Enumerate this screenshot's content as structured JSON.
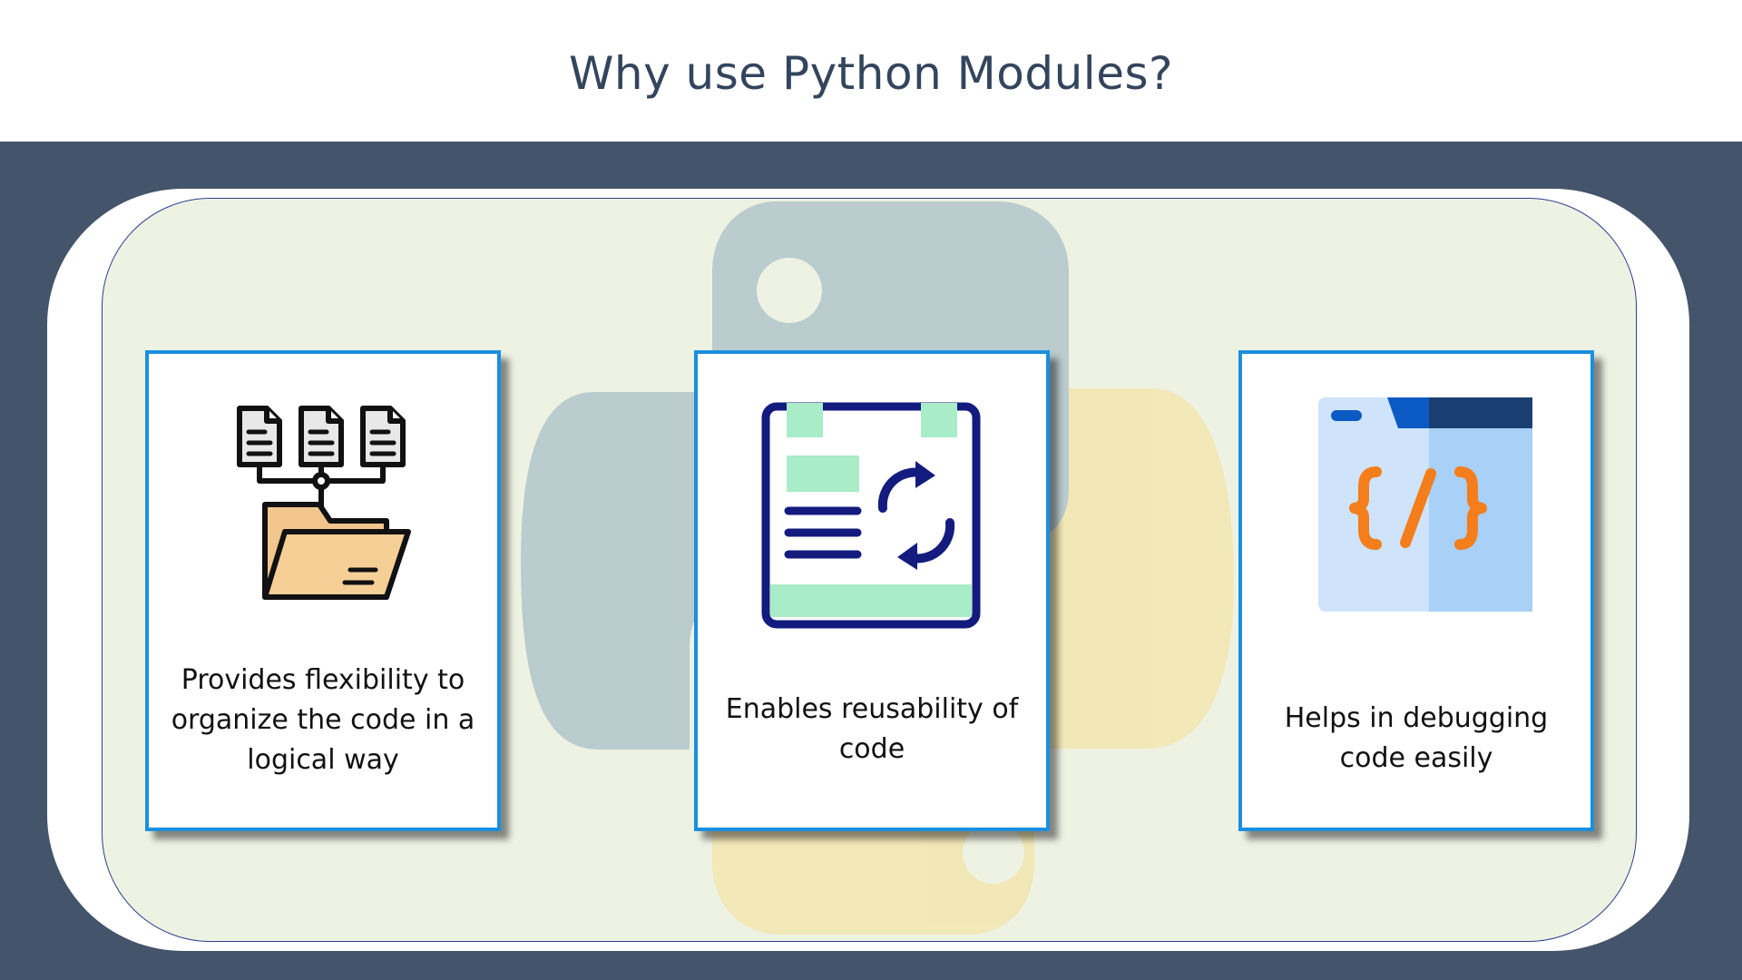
{
  "slide": {
    "title": "Why use Python Modules?"
  },
  "cards": [
    {
      "icon": "folder-documents-icon",
      "text": "Provides flexibility to organize the code in a logical way"
    },
    {
      "icon": "reusable-document-icon",
      "text": "Enables reusability of code"
    },
    {
      "icon": "code-window-icon",
      "text": "Helps in debugging code easily"
    }
  ],
  "colors": {
    "title": "#33455d",
    "band": "#44546a",
    "card_border": "#1a8fe0",
    "inner_panel": "#eef2e3",
    "python_blue": "#b2c6ca",
    "python_yellow": "#f2e6b0"
  }
}
